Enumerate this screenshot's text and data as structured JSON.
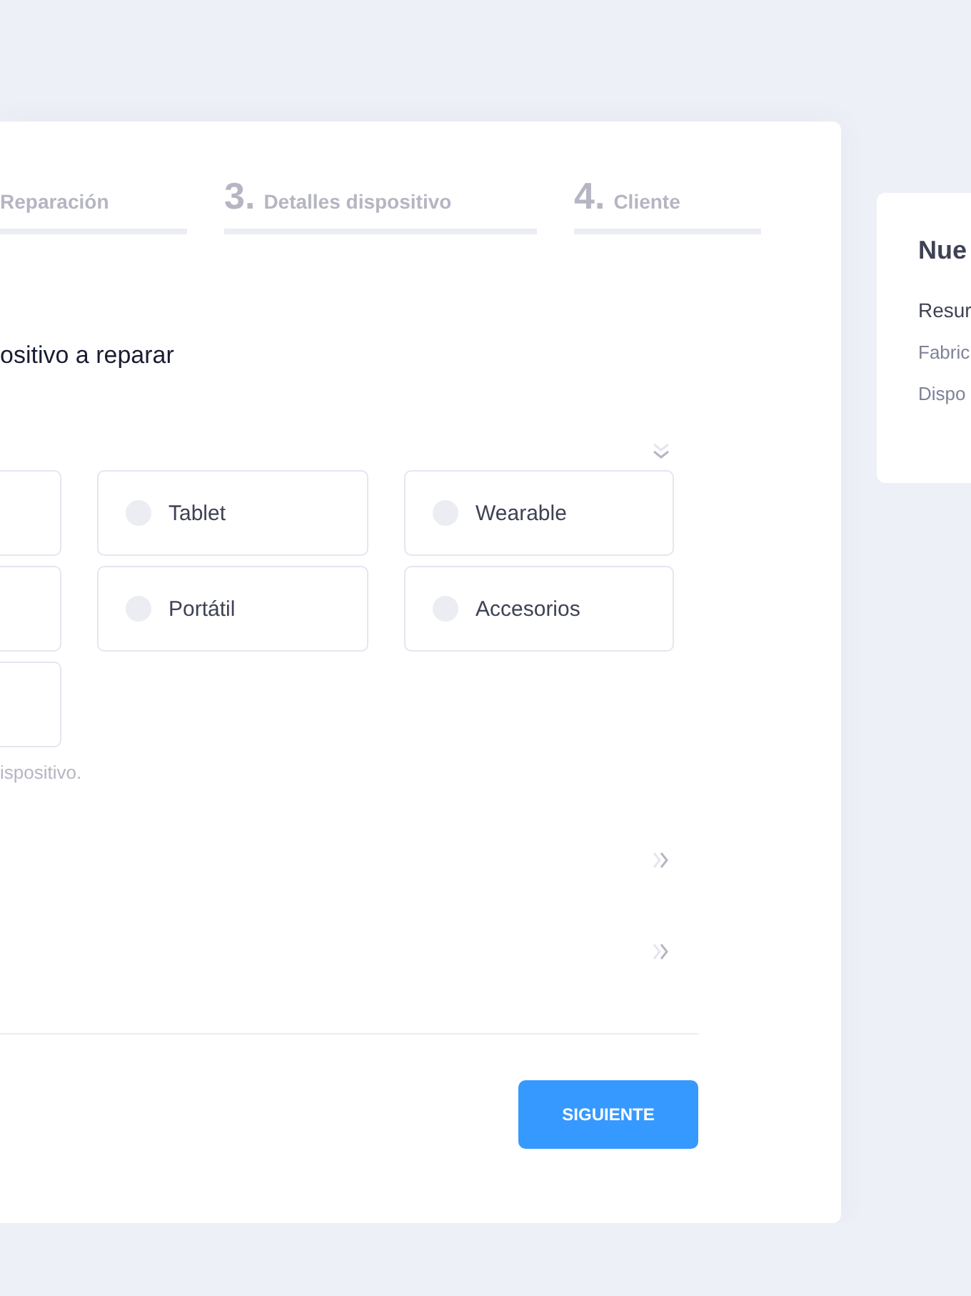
{
  "steps": [
    {
      "label": "Reparación"
    },
    {
      "number": "3.",
      "label": "Detalles dispositivo"
    },
    {
      "number": "4.",
      "label": "Cliente"
    }
  ],
  "section_title": "ositivo a reparar",
  "device_options": [
    {
      "kind": "clipped"
    },
    {
      "kind": "option",
      "label": "Tablet",
      "selected": false
    },
    {
      "kind": "option",
      "label": "Wearable",
      "selected": false
    },
    {
      "kind": "clipped"
    },
    {
      "kind": "option",
      "label": "Portátil",
      "selected": false
    },
    {
      "kind": "option",
      "label": "Accesorios",
      "selected": false
    },
    {
      "kind": "clipped"
    }
  ],
  "helper_text": "ispositivo.",
  "collapsed_sections": [
    {
      "kind": "collapsed"
    },
    {
      "kind": "collapsed"
    }
  ],
  "next_button": "SIGUIENTE",
  "summary": {
    "title": "Nue",
    "subtitle": "Resur",
    "fields": [
      "Fabric",
      "Dispo"
    ]
  }
}
